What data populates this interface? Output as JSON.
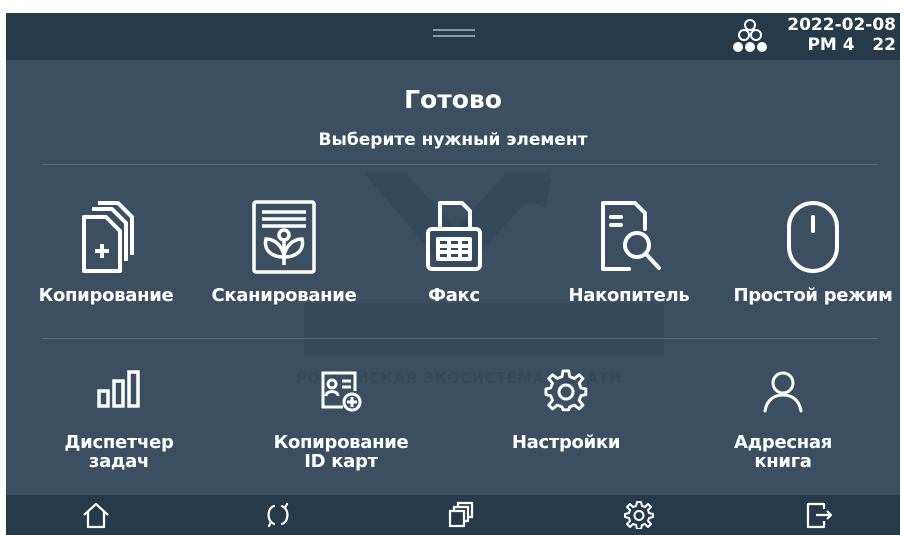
{
  "topbar": {
    "date": "2022-02-08",
    "time": "PM 4   22",
    "toner_icon": "toner-status-icon"
  },
  "main": {
    "status": "Готово",
    "prompt": "Выберите нужный элемент"
  },
  "watermark": {
    "text": "РОССИЙСКАЯ ЭКОСИСТЕМА ПЕЧАТИ"
  },
  "tiles_row1": [
    {
      "label": "Копирование",
      "icon": "copy-icon"
    },
    {
      "label": "Сканирование",
      "icon": "scan-icon"
    },
    {
      "label": "Факс",
      "icon": "fax-icon"
    },
    {
      "label": "Накопитель",
      "icon": "storage-search-icon"
    },
    {
      "label": "Простой режим",
      "icon": "mouse-icon"
    }
  ],
  "tiles_row2": [
    {
      "line1": "Диспетчер",
      "line2": "задач",
      "icon": "bar-chart-icon"
    },
    {
      "line1": "Копирование",
      "line2": "ID карт",
      "icon": "id-card-copy-icon"
    },
    {
      "line1": "Настройки",
      "line2": "",
      "icon": "gear-icon"
    },
    {
      "line1": "Адресная",
      "line2": "книга",
      "icon": "person-icon"
    }
  ],
  "bottombar": [
    "home-icon",
    "refresh-icon",
    "windows-icon",
    "settings-icon",
    "logout-icon"
  ],
  "colors": {
    "background": "#3b4f60",
    "bars": "#263a4a",
    "text": "#ffffff"
  }
}
